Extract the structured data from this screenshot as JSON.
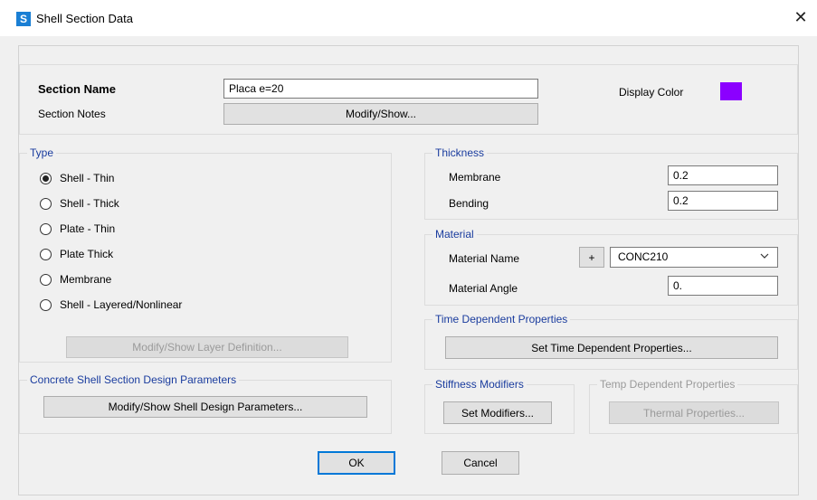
{
  "window": {
    "app_icon": "S",
    "title": "Shell Section Data",
    "close_icon": "✕"
  },
  "header": {
    "section_name_label": "Section Name",
    "section_name_value": "Placa e=20",
    "section_notes_label": "Section Notes",
    "modify_show_button": "Modify/Show...",
    "display_color_label": "Display Color",
    "display_color": "#8b00ff"
  },
  "type": {
    "title": "Type",
    "options": [
      {
        "label": "Shell - Thin",
        "checked": true
      },
      {
        "label": "Shell - Thick",
        "checked": false
      },
      {
        "label": "Plate - Thin",
        "checked": false
      },
      {
        "label": "Plate Thick",
        "checked": false
      },
      {
        "label": "Membrane",
        "checked": false
      },
      {
        "label": "Shell - Layered/Nonlinear",
        "checked": false
      }
    ],
    "layer_button": "Modify/Show Layer Definition..."
  },
  "concrete": {
    "title": "Concrete Shell Section Design Parameters",
    "button": "Modify/Show Shell Design Parameters..."
  },
  "thickness": {
    "title": "Thickness",
    "membrane_label": "Membrane",
    "membrane_value": "0.2",
    "bending_label": "Bending",
    "bending_value": "0.2"
  },
  "material": {
    "title": "Material",
    "name_label": "Material Name",
    "add_button": "+",
    "name_value": "CONC210",
    "angle_label": "Material Angle",
    "angle_value": "0."
  },
  "time": {
    "title": "Time Dependent Properties",
    "button": "Set Time Dependent Properties..."
  },
  "stiffness": {
    "title": "Stiffness Modifiers",
    "button": "Set Modifiers..."
  },
  "temp": {
    "title": "Temp Dependent Properties",
    "button": "Thermal Properties..."
  },
  "footer": {
    "ok": "OK",
    "cancel": "Cancel"
  }
}
